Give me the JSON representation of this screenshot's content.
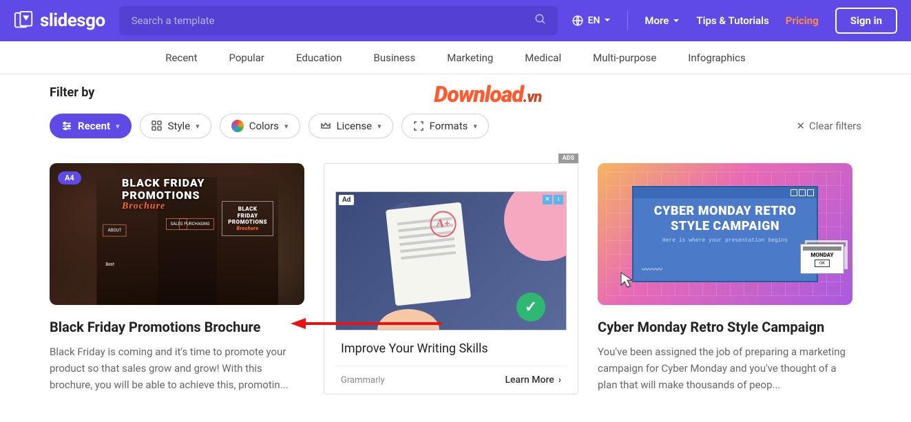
{
  "header": {
    "logo_text": "slidesgo",
    "search_placeholder": "Search a template",
    "lang_label": "EN",
    "more_label": "More",
    "tips_label": "Tips & Tutorials",
    "pricing_label": "Pricing",
    "signin_label": "Sign in"
  },
  "nav": {
    "items": [
      "Recent",
      "Popular",
      "Education",
      "Business",
      "Marketing",
      "Medical",
      "Multi-purpose",
      "Infographics"
    ]
  },
  "watermark": {
    "main": "Download",
    "suffix": ".vn"
  },
  "filters": {
    "label": "Filter by",
    "recent": "Recent",
    "style": "Style",
    "colors": "Colors",
    "license": "License",
    "formats": "Formats",
    "clear": "Clear filters"
  },
  "cards": {
    "c1": {
      "badge": "A4",
      "thumb_heading_line1": "BLACK FRIDAY",
      "thumb_heading_line2": "PROMOTIONS",
      "thumb_heading_script": "Brochure",
      "thumb_mini_line1": "BLACK",
      "thumb_mini_line2": "FRIDAY",
      "thumb_mini_line3": "PROMOTIONS",
      "thumb_mini_script": "Brochure",
      "info_about": "ABOUT",
      "info_sales": "SALES",
      "info_purchasing": "PURCHASING",
      "info_best": "Best",
      "title": "Black Friday Promotions Brochure",
      "desc": "Black Friday is coming and it's time to promote your product so that sales grow and grow! With this brochure, you will be able to achieve this, promotin..."
    },
    "ad": {
      "ads_badge": "ADS",
      "chip": "Ad",
      "grade": "A+",
      "check": "✓",
      "headline": "Improve Your Writing Skills",
      "brand": "Grammarly",
      "cta": "Learn More"
    },
    "c3": {
      "thumb_heading_line1": "CYBER MONDAY RETRO",
      "thumb_heading_line2": "STYLE CAMPAIGN",
      "thumb_sub": "Here is where your presentation begins",
      "mini_label": "MONDAY",
      "mini_ok": "OK",
      "title": "Cyber Monday Retro Style Campaign",
      "desc": "You've been assigned the job of preparing a marketing campaign for Cyber Monday and you've thought of a plan that will make thousands of peop..."
    }
  }
}
